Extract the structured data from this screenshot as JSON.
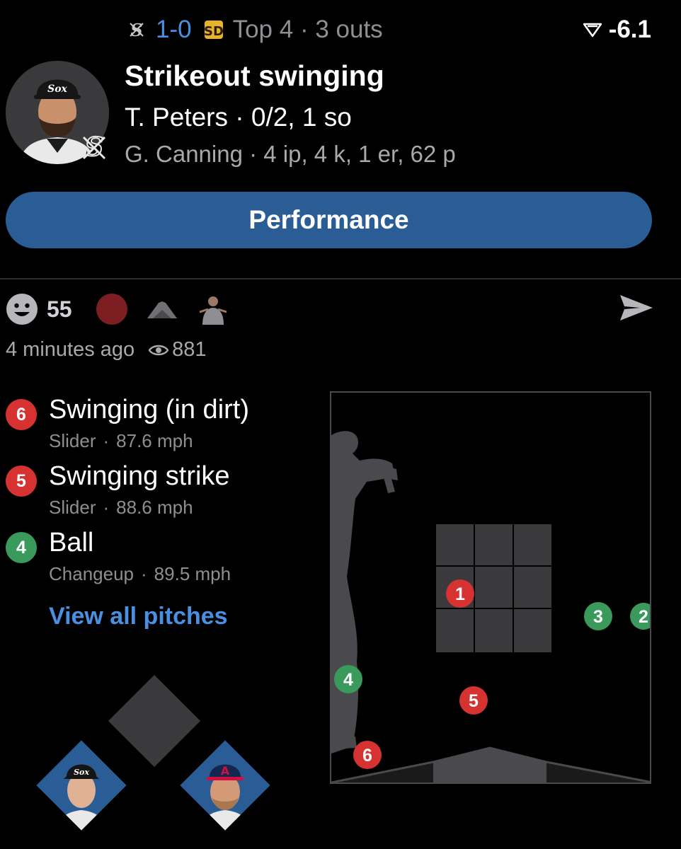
{
  "header": {
    "away_team_icon": "white-sox-logo",
    "score": "1-0",
    "home_team_icon": "padres-logo",
    "inning_status": "Top 4 · 3 outs",
    "win_prob_icon": "win-probability-icon",
    "win_prob_delta": "-6.1"
  },
  "play": {
    "title": "Strikeout swinging",
    "batter_line": "T. Peters · 0/2, 1 so",
    "pitcher_line": "G. Canning · 4 ip, 4 k, 1 er, 62 p",
    "avatar_icon": "player-avatar",
    "team_badge_icon": "white-sox-logo"
  },
  "performance_button": "Performance",
  "reactions": {
    "smiley_icon": "smiley-icon",
    "count": "55",
    "share_icon": "share-icon"
  },
  "meta": {
    "time_ago": "4 minutes ago",
    "view_icon": "eye-icon",
    "views": "881"
  },
  "pitches": [
    {
      "number": "6",
      "result": "Swinging (in dirt)",
      "pitch_type": "Slider",
      "speed": "87.6 mph",
      "status": "strike"
    },
    {
      "number": "5",
      "result": "Swinging strike",
      "pitch_type": "Slider",
      "speed": "88.6 mph",
      "status": "strike"
    },
    {
      "number": "4",
      "result": "Ball",
      "pitch_type": "Changeup",
      "speed": "89.5 mph",
      "status": "ball"
    }
  ],
  "view_all": "View all pitches",
  "zone_markers": [
    {
      "label": "1",
      "status": "strike"
    },
    {
      "label": "2",
      "status": "ball"
    },
    {
      "label": "3",
      "status": "ball"
    },
    {
      "label": "4",
      "status": "ball"
    },
    {
      "label": "5",
      "status": "strike"
    },
    {
      "label": "6",
      "status": "strike"
    }
  ],
  "colors": {
    "strike": "#d63232",
    "ball": "#3a9a5c",
    "accent": "#4a90e2",
    "button": "#2a5d96"
  },
  "sep": "·"
}
